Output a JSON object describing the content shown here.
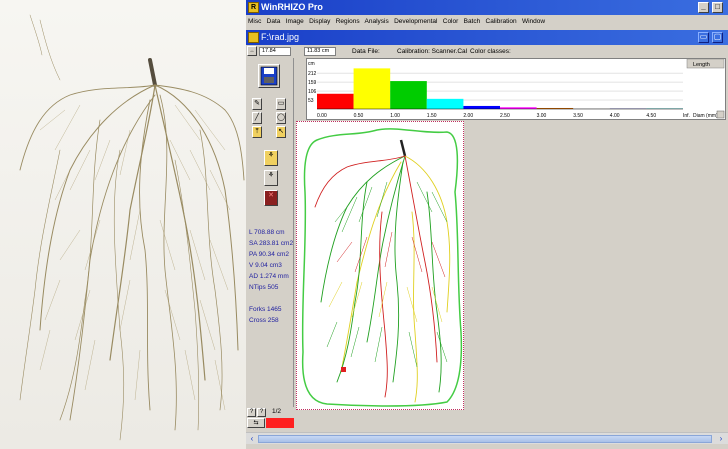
{
  "app": {
    "title": "WinRHIZO Pro",
    "window_controls": [
      "_",
      "□"
    ]
  },
  "menu": {
    "items": [
      "Misc",
      "Data",
      "Image",
      "Display",
      "Regions",
      "Analysis",
      "Developmental",
      "Color",
      "Batch",
      "Calibration",
      "Window"
    ]
  },
  "document": {
    "title": "F:\\rad.jpg"
  },
  "infobar": {
    "field1": "17.84",
    "field2": "11.83 cm",
    "data_file_label": "Data File:",
    "calibration_label": "Calibration: Scanner.Cal",
    "color_classes_label": "Color classes:"
  },
  "stats": {
    "length": "L    708.88 cm",
    "surface_area": "SA  283.81 cm2",
    "projected_area": "PA  90.34 cm2",
    "volume": "V    9.04 cm3",
    "avg_diameter": "AD  1.274 mm",
    "tips": "NTips  505",
    "forks": "Forks  1465",
    "crossings": "Cross  258"
  },
  "pager": {
    "page": "1/2"
  },
  "chart_data": {
    "type": "bar",
    "y_unit_label": "cm",
    "y_ticks": [
      "212",
      "159",
      "106",
      "53"
    ],
    "categories": [
      "0.00-0.50",
      "0.50-1.00",
      "1.00-1.50",
      "1.50-2.00",
      "2.00-2.50",
      "2.50-3.00",
      "3.00-3.50",
      "3.50-4.00",
      "4.00-4.50",
      "4.50-Inf."
    ],
    "values": [
      90,
      240,
      165,
      60,
      18,
      10,
      6,
      3,
      2,
      3
    ],
    "ylim": [
      0,
      260
    ],
    "x_tick_labels": [
      "0.00",
      "0.50",
      "1.00",
      "1.50",
      "2.00",
      "2.50",
      "3.00",
      "3.50",
      "4.00",
      "4.50",
      "Inf.",
      "Diam (mm)"
    ],
    "colors": [
      "#ff0000",
      "#ffff00",
      "#00cc00",
      "#00ffff",
      "#0000ff",
      "#ff00ff",
      "#c06000",
      "#c0c0c0",
      "#000080",
      "#00a0a0"
    ],
    "dropdown_label": "Length",
    "grid": true
  },
  "colors": {
    "titlebar": "#1a3fc8",
    "panel": "#d4d0c8",
    "outline": "#44cc44",
    "stat_text": "#2020a0"
  }
}
